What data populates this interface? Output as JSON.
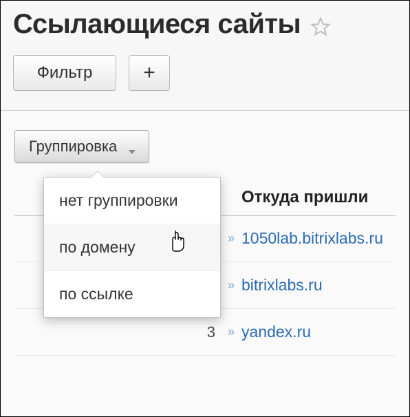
{
  "header": {
    "title": "Ссылающиеся сайты"
  },
  "toolbar": {
    "filter_label": "Фильтр",
    "add_label": "+"
  },
  "grouping": {
    "button_label": "Группировка",
    "menu": {
      "none": "нет группировки",
      "by_domain": "по домену",
      "by_link": "по ссылке"
    }
  },
  "table": {
    "column_source": "Откуда пришли",
    "rows": [
      {
        "num": "",
        "link": "1050lab.bitrixlabs.ru"
      },
      {
        "num": "",
        "link": "bitrixlabs.ru"
      },
      {
        "num": "3",
        "link": "yandex.ru"
      }
    ]
  }
}
